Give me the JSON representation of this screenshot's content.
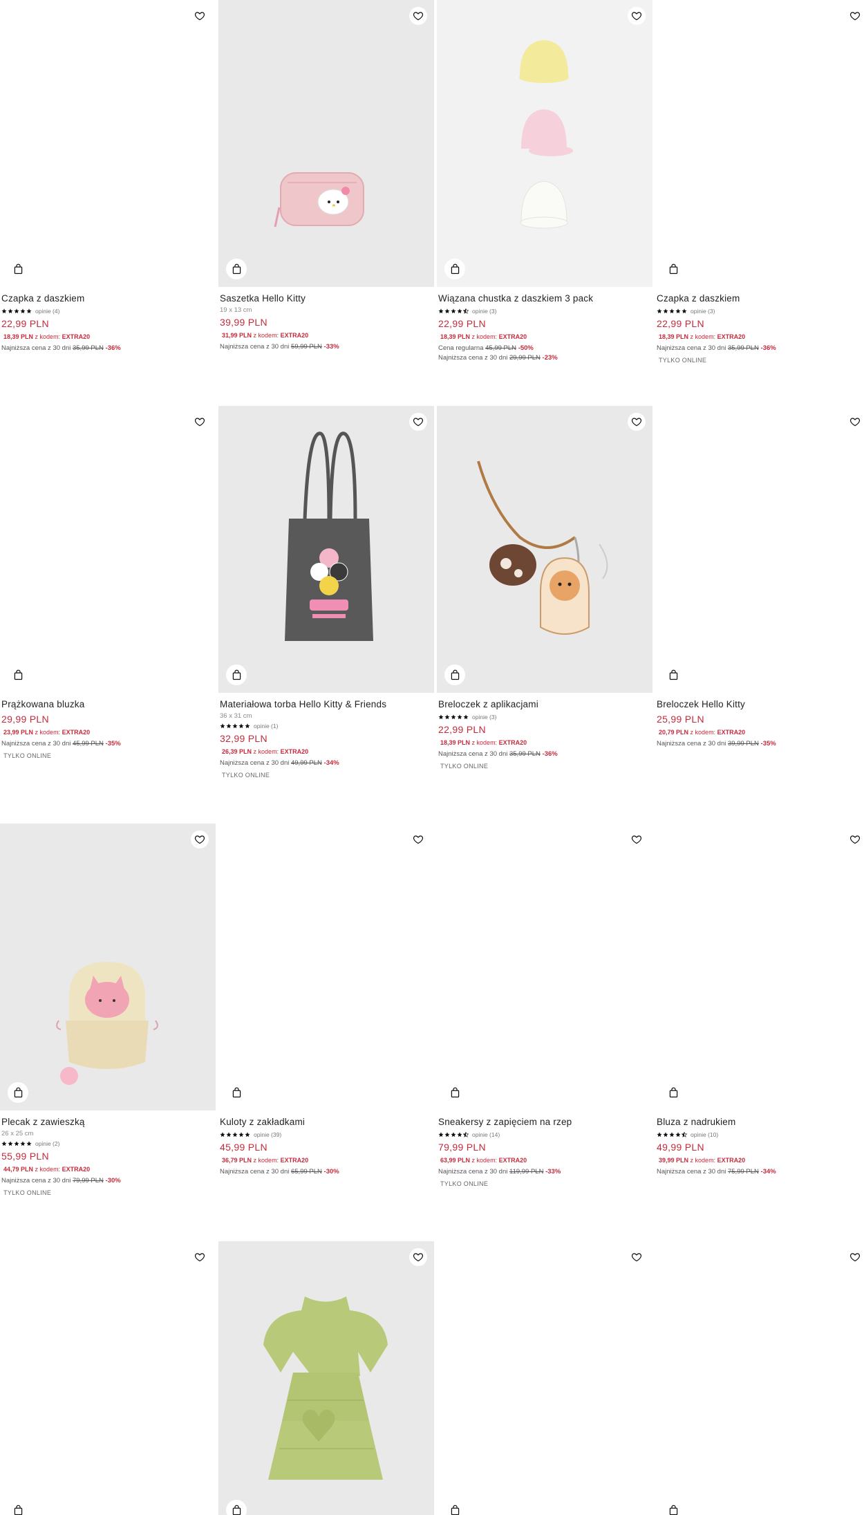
{
  "products": [
    {
      "name": "Czapka z daszkiem",
      "rating_text": "opinie (4)",
      "price": "22,99 PLN",
      "promo_price": "18,39 PLN",
      "promo_label": "z kodem:",
      "promo_code": "EXTRA20",
      "lowest_label": "Najniższa cena z 30 dni",
      "lowest_old": "35,99 PLN",
      "lowest_disc": "-36%"
    },
    {
      "name": "Saszetka Hello Kitty",
      "dims": "19 x 13 cm",
      "price": "39,99 PLN",
      "promo_price": "31,99 PLN",
      "promo_label": "z kodem:",
      "promo_code": "EXTRA20",
      "lowest_label": "Najniższa cena z 30 dni",
      "lowest_old": "59,99 PLN",
      "lowest_disc": "-33%"
    },
    {
      "name": "Wiązana chustka z daszkiem 3 pack",
      "rating_text": "opinie (3)",
      "price": "22,99 PLN",
      "promo_price": "18,39 PLN",
      "promo_label": "z kodem:",
      "promo_code": "EXTRA20",
      "regular_label": "Cena regularna",
      "regular_old": "45,99 PLN",
      "regular_disc": "-50%",
      "lowest_label": "Najniższa cena z 30 dni",
      "lowest_old": "29,99 PLN",
      "lowest_disc": "-23%"
    },
    {
      "name": "Czapka z daszkiem",
      "rating_text": "opinie (3)",
      "price": "22,99 PLN",
      "promo_price": "18,39 PLN",
      "promo_label": "z kodem:",
      "promo_code": "EXTRA20",
      "lowest_label": "Najniższa cena z 30 dni",
      "lowest_old": "35,99 PLN",
      "lowest_disc": "-36%",
      "online": "TYLKO ONLINE"
    },
    {
      "name": "Prążkowana bluzka",
      "price": "29,99 PLN",
      "promo_price": "23,99 PLN",
      "promo_label": "z kodem:",
      "promo_code": "EXTRA20",
      "lowest_label": "Najniższa cena z 30 dni",
      "lowest_old": "45,99 PLN",
      "lowest_disc": "-35%",
      "online": "TYLKO ONLINE"
    },
    {
      "name": "Materiałowa torba Hello Kitty & Friends",
      "dims": "36 x 31 cm",
      "rating_text": "opinie (1)",
      "price": "32,99 PLN",
      "promo_price": "26,39 PLN",
      "promo_label": "z kodem:",
      "promo_code": "EXTRA20",
      "lowest_label": "Najniższa cena z 30 dni",
      "lowest_old": "49,99 PLN",
      "lowest_disc": "-34%",
      "online": "TYLKO ONLINE"
    },
    {
      "name": "Breloczek z aplikacjami",
      "rating_text": "opinie (3)",
      "price": "22,99 PLN",
      "promo_price": "18,39 PLN",
      "promo_label": "z kodem:",
      "promo_code": "EXTRA20",
      "lowest_label": "Najniższa cena z 30 dni",
      "lowest_old": "35,99 PLN",
      "lowest_disc": "-36%",
      "online": "TYLKO ONLINE"
    },
    {
      "name": "Breloczek Hello Kitty",
      "price": "25,99 PLN",
      "promo_price": "20,79 PLN",
      "promo_label": "z kodem:",
      "promo_code": "EXTRA20",
      "lowest_label": "Najniższa cena z 30 dni",
      "lowest_old": "39,99 PLN",
      "lowest_disc": "-35%"
    },
    {
      "name": "Plecak z zawieszką",
      "dims": "26 x 25 cm",
      "rating_text": "opinie (2)",
      "price": "55,99 PLN",
      "promo_price": "44,79 PLN",
      "promo_label": "z kodem:",
      "promo_code": "EXTRA20",
      "lowest_label": "Najniższa cena z 30 dni",
      "lowest_old": "79,99 PLN",
      "lowest_disc": "-30%",
      "online": "TYLKO ONLINE"
    },
    {
      "name": "Kuloty z zakładkami",
      "rating_text": "opinie (39)",
      "price": "45,99 PLN",
      "promo_price": "36,79 PLN",
      "promo_label": "z kodem:",
      "promo_code": "EXTRA20",
      "lowest_label": "Najniższa cena z 30 dni",
      "lowest_old": "65,99 PLN",
      "lowest_disc": "-30%"
    },
    {
      "name": "Sneakersy z zapięciem na rzep",
      "rating_text": "opinie (14)",
      "price": "79,99 PLN",
      "promo_price": "63,99 PLN",
      "promo_label": "z kodem:",
      "promo_code": "EXTRA20",
      "lowest_label": "Najniższa cena z 30 dni",
      "lowest_old": "119,99 PLN",
      "lowest_disc": "-33%",
      "online": "TYLKO ONLINE"
    },
    {
      "name": "Bluza z nadrukiem",
      "rating_text": "opinie (10)",
      "price": "49,99 PLN",
      "promo_price": "39,99 PLN",
      "promo_label": "z kodem:",
      "promo_code": "EXTRA20",
      "lowest_label": "Najniższa cena z 30 dni",
      "lowest_old": "75,99 PLN",
      "lowest_disc": "-34%"
    }
  ],
  "icons": {
    "favorite": "heart-icon",
    "add_to_cart": "shopping-bag-icon",
    "rating": "star-icon"
  },
  "colors": {
    "price": "#c52a3b",
    "text": "#222222",
    "muted": "#777777"
  }
}
